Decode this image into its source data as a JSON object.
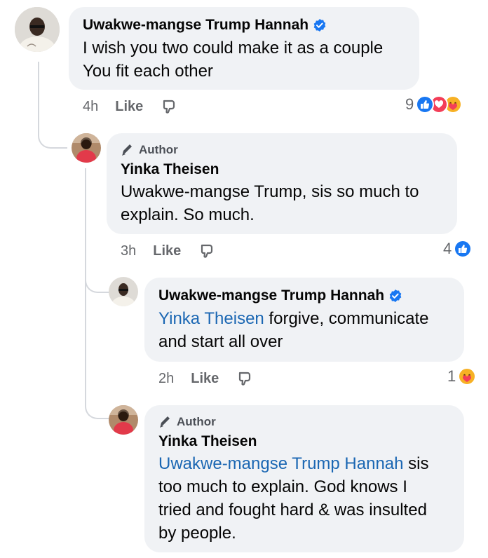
{
  "comments": [
    {
      "name": "Uwakwe-mangse Trump Hannah",
      "text_lines": [
        "I wish you two could make it as a couple",
        "You fit each other"
      ],
      "time": "4h",
      "like_label": "Like",
      "reaction_count": "9",
      "reactions": [
        "like-reaction-icon",
        "love-reaction-icon",
        "care-reaction-icon"
      ]
    },
    {
      "badge": "Author",
      "name": "Yinka Theisen",
      "text_lines": [
        "Uwakwe-mangse Trump, sis so much to",
        "explain. So much."
      ],
      "time": "3h",
      "like_label": "Like",
      "reaction_count": "4",
      "reactions": [
        "like-reaction-icon"
      ]
    },
    {
      "name": "Uwakwe-mangse Trump Hannah",
      "mention": "Yinka Theisen",
      "text_after_mention": " forgive, communicate",
      "text_line2": "and start all over",
      "time": "2h",
      "like_label": "Like",
      "reaction_count": "1",
      "reactions": [
        "care-reaction-icon"
      ]
    },
    {
      "badge": "Author",
      "name": "Yinka Theisen",
      "mention": "Uwakwe-mangse Trump Hannah",
      "text_after_mention": " sis",
      "text_lines": [
        "too much to explain. God knows I",
        "tried and fought hard & was insulted",
        "by people."
      ]
    }
  ],
  "colors": {
    "bubble": "#f0f2f5",
    "mention": "#1b67b3",
    "verified": "#1877f2",
    "like_blue": "#1877f2",
    "love_red": "#f33e58",
    "care_yellow": "#f7b125"
  }
}
